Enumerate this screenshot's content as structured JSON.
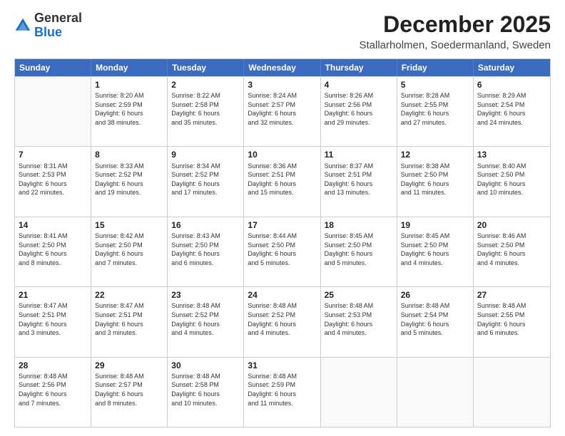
{
  "logo": {
    "general": "General",
    "blue": "Blue"
  },
  "title": "December 2025",
  "subtitle": "Stallarholmen, Soedermanland, Sweden",
  "days": [
    "Sunday",
    "Monday",
    "Tuesday",
    "Wednesday",
    "Thursday",
    "Friday",
    "Saturday"
  ],
  "weeks": [
    [
      {
        "day": "",
        "info": ""
      },
      {
        "day": "1",
        "info": "Sunrise: 8:20 AM\nSunset: 2:59 PM\nDaylight: 6 hours\nand 38 minutes."
      },
      {
        "day": "2",
        "info": "Sunrise: 8:22 AM\nSunset: 2:58 PM\nDaylight: 6 hours\nand 35 minutes."
      },
      {
        "day": "3",
        "info": "Sunrise: 8:24 AM\nSunset: 2:57 PM\nDaylight: 6 hours\nand 32 minutes."
      },
      {
        "day": "4",
        "info": "Sunrise: 8:26 AM\nSunset: 2:56 PM\nDaylight: 6 hours\nand 29 minutes."
      },
      {
        "day": "5",
        "info": "Sunrise: 8:28 AM\nSunset: 2:55 PM\nDaylight: 6 hours\nand 27 minutes."
      },
      {
        "day": "6",
        "info": "Sunrise: 8:29 AM\nSunset: 2:54 PM\nDaylight: 6 hours\nand 24 minutes."
      }
    ],
    [
      {
        "day": "7",
        "info": "Sunrise: 8:31 AM\nSunset: 2:53 PM\nDaylight: 6 hours\nand 22 minutes."
      },
      {
        "day": "8",
        "info": "Sunrise: 8:33 AM\nSunset: 2:52 PM\nDaylight: 6 hours\nand 19 minutes."
      },
      {
        "day": "9",
        "info": "Sunrise: 8:34 AM\nSunset: 2:52 PM\nDaylight: 6 hours\nand 17 minutes."
      },
      {
        "day": "10",
        "info": "Sunrise: 8:36 AM\nSunset: 2:51 PM\nDaylight: 6 hours\nand 15 minutes."
      },
      {
        "day": "11",
        "info": "Sunrise: 8:37 AM\nSunset: 2:51 PM\nDaylight: 6 hours\nand 13 minutes."
      },
      {
        "day": "12",
        "info": "Sunrise: 8:38 AM\nSunset: 2:50 PM\nDaylight: 6 hours\nand 11 minutes."
      },
      {
        "day": "13",
        "info": "Sunrise: 8:40 AM\nSunset: 2:50 PM\nDaylight: 6 hours\nand 10 minutes."
      }
    ],
    [
      {
        "day": "14",
        "info": "Sunrise: 8:41 AM\nSunset: 2:50 PM\nDaylight: 6 hours\nand 8 minutes."
      },
      {
        "day": "15",
        "info": "Sunrise: 8:42 AM\nSunset: 2:50 PM\nDaylight: 6 hours\nand 7 minutes."
      },
      {
        "day": "16",
        "info": "Sunrise: 8:43 AM\nSunset: 2:50 PM\nDaylight: 6 hours\nand 6 minutes."
      },
      {
        "day": "17",
        "info": "Sunrise: 8:44 AM\nSunset: 2:50 PM\nDaylight: 6 hours\nand 5 minutes."
      },
      {
        "day": "18",
        "info": "Sunrise: 8:45 AM\nSunset: 2:50 PM\nDaylight: 6 hours\nand 5 minutes."
      },
      {
        "day": "19",
        "info": "Sunrise: 8:45 AM\nSunset: 2:50 PM\nDaylight: 6 hours\nand 4 minutes."
      },
      {
        "day": "20",
        "info": "Sunrise: 8:46 AM\nSunset: 2:50 PM\nDaylight: 6 hours\nand 4 minutes."
      }
    ],
    [
      {
        "day": "21",
        "info": "Sunrise: 8:47 AM\nSunset: 2:51 PM\nDaylight: 6 hours\nand 3 minutes."
      },
      {
        "day": "22",
        "info": "Sunrise: 8:47 AM\nSunset: 2:51 PM\nDaylight: 6 hours\nand 3 minutes."
      },
      {
        "day": "23",
        "info": "Sunrise: 8:48 AM\nSunset: 2:52 PM\nDaylight: 6 hours\nand 4 minutes."
      },
      {
        "day": "24",
        "info": "Sunrise: 8:48 AM\nSunset: 2:52 PM\nDaylight: 6 hours\nand 4 minutes."
      },
      {
        "day": "25",
        "info": "Sunrise: 8:48 AM\nSunset: 2:53 PM\nDaylight: 6 hours\nand 4 minutes."
      },
      {
        "day": "26",
        "info": "Sunrise: 8:48 AM\nSunset: 2:54 PM\nDaylight: 6 hours\nand 5 minutes."
      },
      {
        "day": "27",
        "info": "Sunrise: 8:48 AM\nSunset: 2:55 PM\nDaylight: 6 hours\nand 6 minutes."
      }
    ],
    [
      {
        "day": "28",
        "info": "Sunrise: 8:48 AM\nSunset: 2:56 PM\nDaylight: 6 hours\nand 7 minutes."
      },
      {
        "day": "29",
        "info": "Sunrise: 8:48 AM\nSunset: 2:57 PM\nDaylight: 6 hours\nand 8 minutes."
      },
      {
        "day": "30",
        "info": "Sunrise: 8:48 AM\nSunset: 2:58 PM\nDaylight: 6 hours\nand 10 minutes."
      },
      {
        "day": "31",
        "info": "Sunrise: 8:48 AM\nSunset: 2:59 PM\nDaylight: 6 hours\nand 11 minutes."
      },
      {
        "day": "",
        "info": ""
      },
      {
        "day": "",
        "info": ""
      },
      {
        "day": "",
        "info": ""
      }
    ]
  ]
}
